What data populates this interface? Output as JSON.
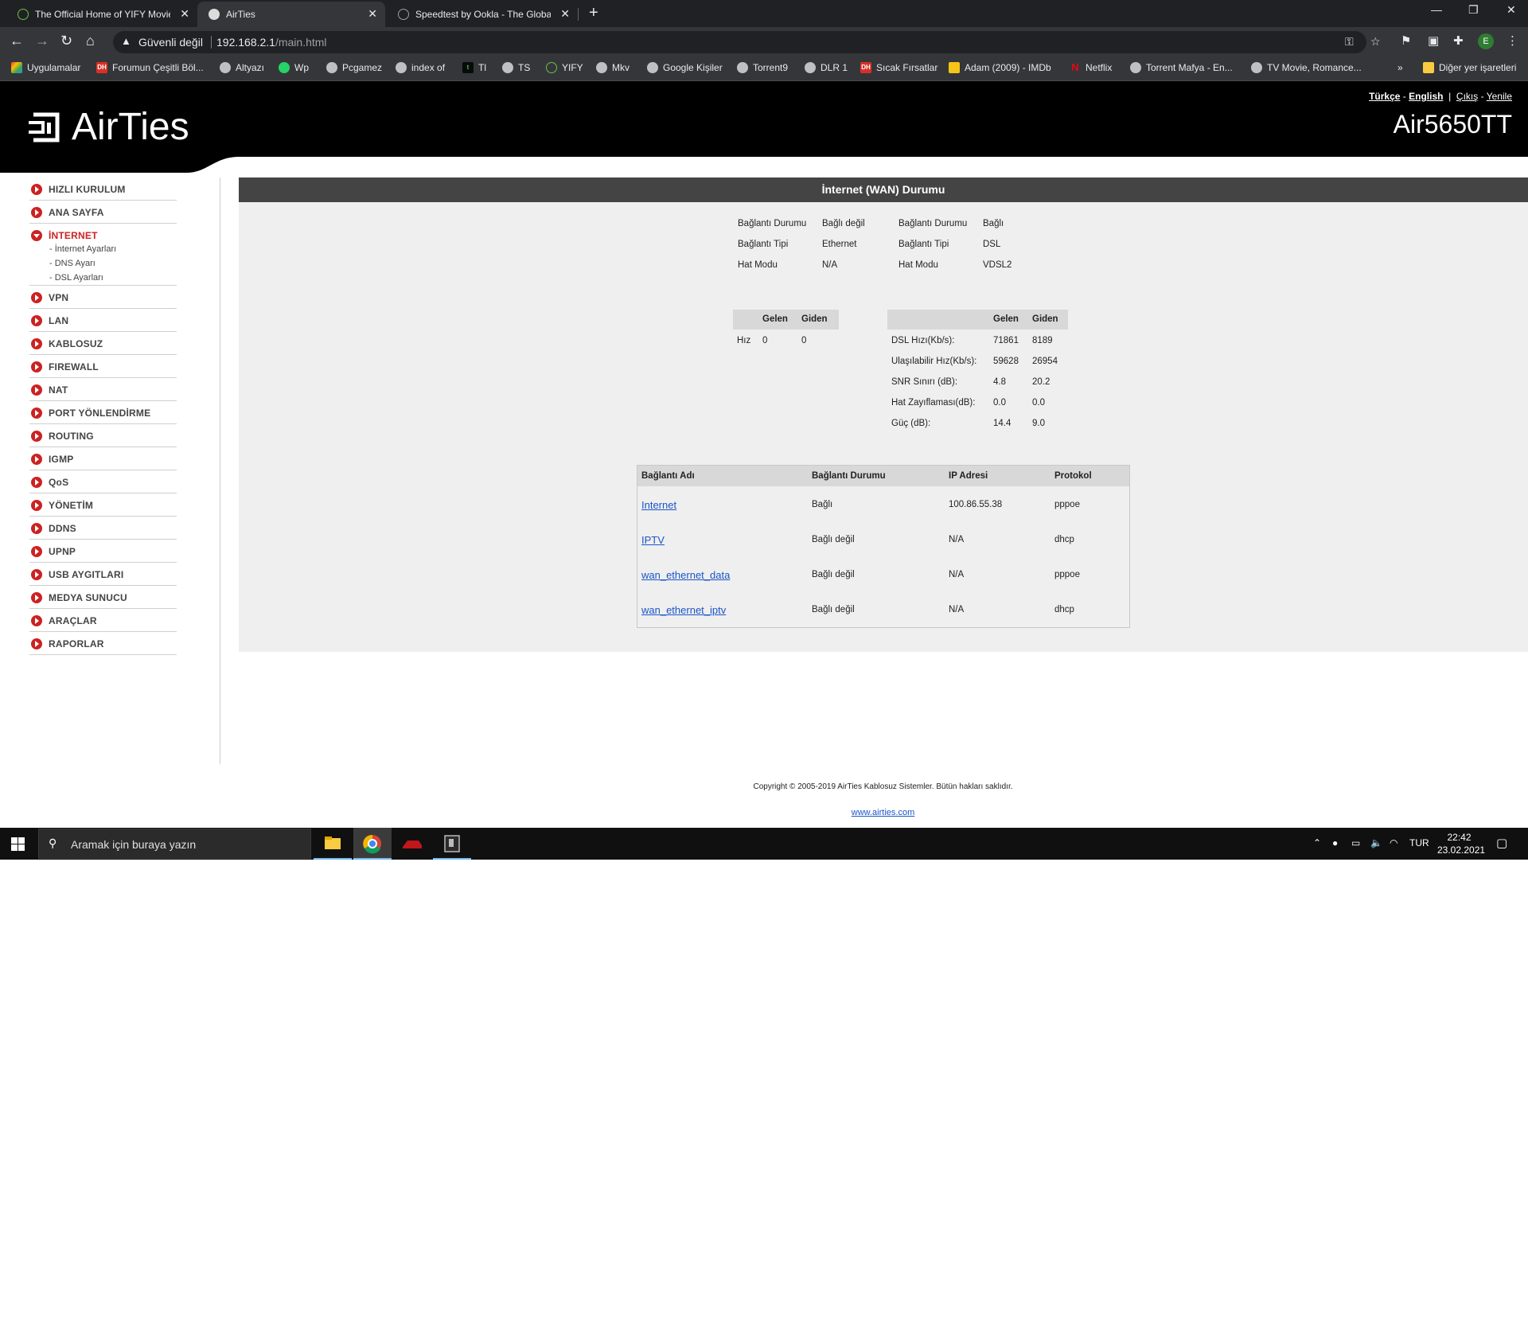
{
  "browser": {
    "tabs": [
      {
        "title": "The Official Home of YIFY Movies",
        "favicon": "yify-icon",
        "active": false
      },
      {
        "title": "AirTies",
        "favicon": "globe-icon",
        "active": true
      },
      {
        "title": "Speedtest by Ookla - The Global",
        "favicon": "speedtest-icon",
        "active": false
      }
    ],
    "address": {
      "security": "Güvenli değil",
      "host": "192.168.2.1",
      "path": "/main.html"
    },
    "profile_initial": "E",
    "bookmarks": [
      {
        "label": "Uygulamalar",
        "icon": "apps-grid-icon"
      },
      {
        "label": "Forumun Çeşitli Böl...",
        "icon": "dh-icon"
      },
      {
        "label": "Altyazı",
        "icon": "globe-icon"
      },
      {
        "label": "Wp",
        "icon": "whatsapp-icon"
      },
      {
        "label": "Pcgamez",
        "icon": "globe-icon"
      },
      {
        "label": "index of",
        "icon": "globe-icon"
      },
      {
        "label": "Tl",
        "icon": "tl-icon"
      },
      {
        "label": "TS",
        "icon": "globe-icon"
      },
      {
        "label": "YIFY",
        "icon": "yify-icon"
      },
      {
        "label": "Mkv",
        "icon": "globe-icon"
      },
      {
        "label": "Google Kişiler",
        "icon": "globe-icon"
      },
      {
        "label": "Torrent9",
        "icon": "globe-icon"
      },
      {
        "label": "DLR 1",
        "icon": "globe-icon"
      },
      {
        "label": "Sıcak Fırsatlar",
        "icon": "dh-icon"
      },
      {
        "label": "Adam (2009) - IMDb",
        "icon": "imdb-icon"
      },
      {
        "label": "Netflix",
        "icon": "netflix-icon"
      },
      {
        "label": "Torrent Mafya - En...",
        "icon": "globe-icon"
      },
      {
        "label": "TV Movie, Romance...",
        "icon": "globe-icon"
      }
    ],
    "more_bookmarks": "»",
    "other_bookmarks": "Diğer yer işaretleri"
  },
  "header": {
    "brand": "AirTies",
    "model": "Air5650TT",
    "lang_tr": "Türkçe",
    "lang_sep": "-",
    "lang_en": "English",
    "bar": "|",
    "logout": "Çıkış",
    "refresh": "Yenile"
  },
  "sidebar": {
    "items": [
      {
        "label": "HIZLI KURULUM"
      },
      {
        "label": "ANA SAYFA"
      },
      {
        "label": "İNTERNET",
        "sub": [
          "- İnternet Ayarları",
          "- DNS Ayarı",
          "- DSL Ayarları"
        ]
      },
      {
        "label": "VPN"
      },
      {
        "label": "LAN"
      },
      {
        "label": "KABLOSUZ"
      },
      {
        "label": "FIREWALL"
      },
      {
        "label": "NAT"
      },
      {
        "label": "PORT YÖNLENDİRME"
      },
      {
        "label": "ROUTING"
      },
      {
        "label": "IGMP"
      },
      {
        "label": "QoS"
      },
      {
        "label": "YÖNETİM"
      },
      {
        "label": "DDNS"
      },
      {
        "label": "UPNP"
      },
      {
        "label": "USB AYGITLARI"
      },
      {
        "label": "MEDYA SUNUCU"
      },
      {
        "label": "ARAÇLAR"
      },
      {
        "label": "RAPORLAR"
      }
    ]
  },
  "main": {
    "title": "İnternet (WAN) Durumu",
    "eth": {
      "rows": [
        {
          "label": "Bağlantı Durumu",
          "value": "Bağlı değil"
        },
        {
          "label": "Bağlantı Tipi",
          "value": "Ethernet"
        },
        {
          "label": "Hat Modu",
          "value": "N/A"
        }
      ],
      "speed": {
        "col_in": "Gelen",
        "col_out": "Giden",
        "label": "Hız",
        "in": "0",
        "out": "0"
      }
    },
    "dsl": {
      "rows": [
        {
          "label": "Bağlantı Durumu",
          "value": "Bağlı"
        },
        {
          "label": "Bağlantı Tipi",
          "value": "DSL"
        },
        {
          "label": "Hat Modu",
          "value": "VDSL2"
        }
      ],
      "stats": {
        "col_in": "Gelen",
        "col_out": "Giden",
        "rows": [
          {
            "label": "DSL Hızı(Kb/s):",
            "in": "71861",
            "out": "8189"
          },
          {
            "label": "Ulaşılabilir Hız(Kb/s):",
            "in": "59628",
            "out": "26954"
          },
          {
            "label": "SNR Sınırı (dB):",
            "in": "4.8",
            "out": "20.2"
          },
          {
            "label": "Hat Zayıflaması(dB):",
            "in": "0.0",
            "out": "0.0"
          },
          {
            "label": "Güç (dB):",
            "in": "14.4",
            "out": "9.0"
          }
        ]
      }
    },
    "connections": {
      "headers": [
        "Bağlantı Adı",
        "Bağlantı Durumu",
        "IP Adresi",
        "Protokol"
      ],
      "rows": [
        {
          "name": "Internet",
          "status": "Bağlı",
          "ip": "100.86.55.38",
          "protocol": "pppoe"
        },
        {
          "name": "IPTV",
          "status": "Bağlı değil",
          "ip": "N/A",
          "protocol": "dhcp"
        },
        {
          "name": "wan_ethernet_data",
          "status": "Bağlı değil",
          "ip": "N/A",
          "protocol": "pppoe"
        },
        {
          "name": "wan_ethernet_iptv",
          "status": "Bağlı değil",
          "ip": "N/A",
          "protocol": "dhcp"
        }
      ]
    }
  },
  "footer": {
    "copyright": "Copyright © 2005-2019 AirTies Kablosuz Sistemler. Bütün hakları saklıdır.",
    "link": "www.airties.com"
  },
  "taskbar": {
    "search_placeholder": "Aramak için buraya yazın",
    "language": "TUR",
    "time": "22:42",
    "date": "23.02.2021"
  },
  "colors": {
    "brand_black": "#000000",
    "menu_red": "#cc2222",
    "link_blue": "#1a55c9",
    "panel_gray": "#efefef",
    "title_bar": "#444444"
  }
}
